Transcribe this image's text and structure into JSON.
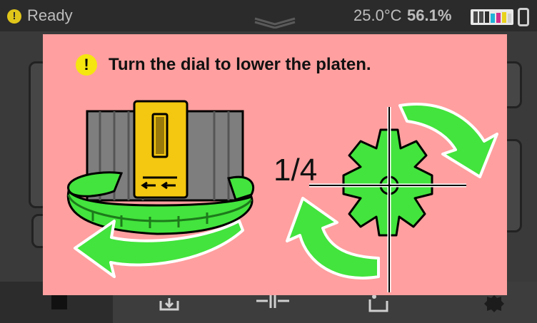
{
  "status_bar": {
    "state": "Ready",
    "temperature": "25.0°C",
    "humidity": "56.1%",
    "icons": [
      "warning-icon",
      "menu-handle-icon",
      "ink-level-icon",
      "usb-icon"
    ]
  },
  "dialog": {
    "message": "Turn the dial to lower the platen.",
    "rotation_fraction": "1/4",
    "icons": [
      "warning-icon",
      "platen-dial-illustration",
      "gear-rotation-icon"
    ]
  },
  "colors": {
    "dialog_bg": "#ff9f9f",
    "accent_green": "#3ee83a",
    "warning_yellow": "#f5e60f",
    "status_bar_bg": "#2b2b2b"
  },
  "bottom_nav": {
    "icons": [
      "home-icon",
      "download-icon",
      "align-icon",
      "ink-cartridge-icon",
      "settings-icon"
    ]
  }
}
